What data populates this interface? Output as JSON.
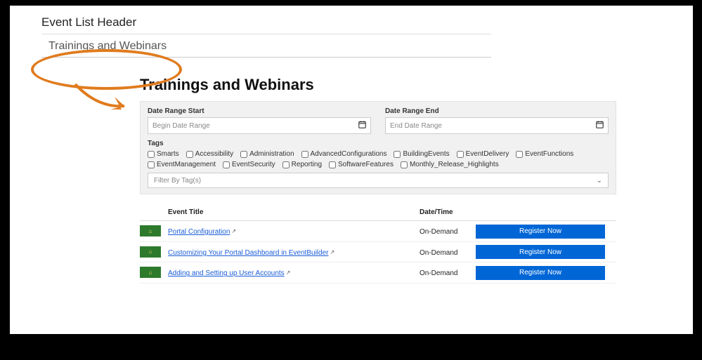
{
  "header": {
    "label": "Event List Header",
    "value": "Trainings and Webinars"
  },
  "main": {
    "title": "Trainings and Webinars"
  },
  "filters": {
    "dateStart": {
      "label": "Date Range Start",
      "placeholder": "Begin Date Range"
    },
    "dateEnd": {
      "label": "Date Range End",
      "placeholder": "End Date Range"
    },
    "tagsLabel": "Tags",
    "tags": [
      "Smarts",
      "Accessibility",
      "Administration",
      "AdvancedConfigurations",
      "BuildingEvents",
      "EventDelivery",
      "EventFunctions",
      "EventManagement",
      "EventSecurity",
      "Reporting",
      "SoftwareFeatures",
      "Monthly_Release_Highlights"
    ],
    "selectPlaceholder": "Filter By Tag(s)"
  },
  "table": {
    "columns": {
      "title": "Event Title",
      "datetime": "Date/Time"
    },
    "rows": [
      {
        "title": "Portal Configuration",
        "datetime": "On-Demand",
        "button": "Register Now"
      },
      {
        "title": "Customizing Your Portal Dashboard in EventBuilder",
        "datetime": "On-Demand",
        "button": "Register Now"
      },
      {
        "title": "Adding and Setting up User Accounts",
        "datetime": "On-Demand",
        "button": "Register Now"
      }
    ]
  }
}
